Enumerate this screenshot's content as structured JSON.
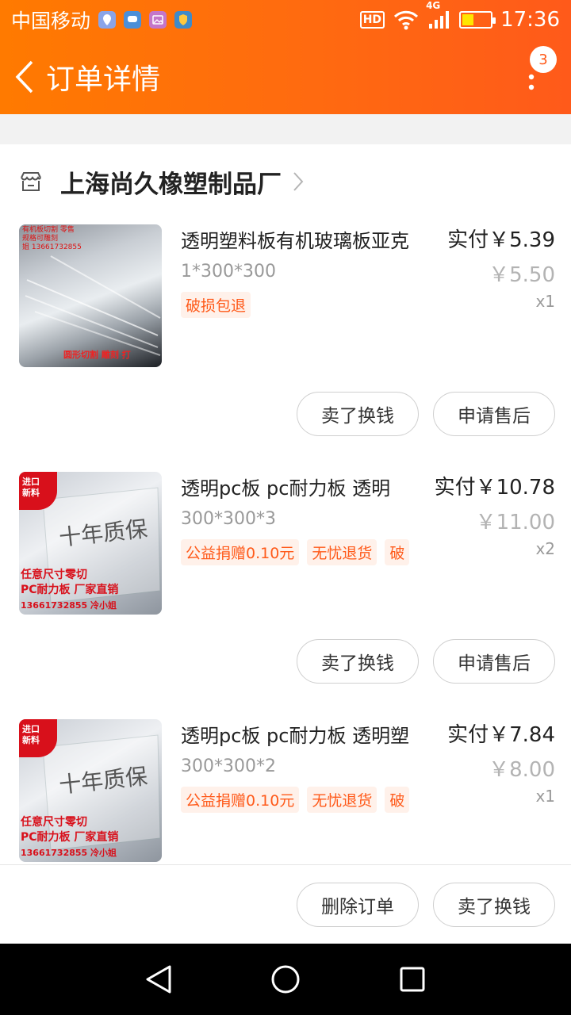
{
  "status_bar": {
    "carrier": "中国移动",
    "hd": "HD",
    "network": "4G",
    "time": "17:36"
  },
  "header": {
    "title": "订单详情",
    "notification_count": "3"
  },
  "shop": {
    "name": "上海尚久橡塑制品厂"
  },
  "items": [
    {
      "title": "透明塑料板有机玻璃板亚克",
      "spec": "1*300*300",
      "tags": [
        "破损包退"
      ],
      "paid": "实付￥5.39",
      "original_price": "￥5.50",
      "quantity": "x1",
      "thumb_text_top": [
        "有机板切割 零售",
        "规格可雕刻",
        "姐 13661732855"
      ],
      "thumb_text_bottom": "圆形切割 雕刻 打",
      "button_left": "卖了换钱",
      "button_right": "申请售后"
    },
    {
      "title": "透明pc板 pc耐力板 透明",
      "spec": "300*300*3",
      "tags": [
        "公益捐赠0.10元",
        "无忧退货",
        "破"
      ],
      "paid": "实付￥10.78",
      "original_price": "￥11.00",
      "quantity": "x2",
      "thumb_badge": "进口\n新料",
      "thumb_text_center": "十年质保",
      "thumb_text_lines": [
        "任意尺寸零切",
        "PC耐力板 厂家直销",
        "13661732855 冷小姐"
      ],
      "button_left": "卖了换钱",
      "button_right": "申请售后"
    },
    {
      "title": "透明pc板 pc耐力板 透明塑",
      "spec": "300*300*2",
      "tags": [
        "公益捐赠0.10元",
        "无忧退货",
        "破"
      ],
      "paid": "实付￥7.84",
      "original_price": "￥8.00",
      "quantity": "x1",
      "thumb_badge": "进口\n新料",
      "thumb_text_center": "十年质保",
      "thumb_text_lines": [
        "任意尺寸零切",
        "PC耐力板 厂家直销",
        "13661732855 冷小姐"
      ]
    }
  ],
  "footer": {
    "delete_label": "删除订单",
    "sell_label": "卖了换钱"
  },
  "colors": {
    "brand": "#ff6a10",
    "tag_text": "#ff5a1a",
    "tag_bg": "#fff1ea"
  }
}
